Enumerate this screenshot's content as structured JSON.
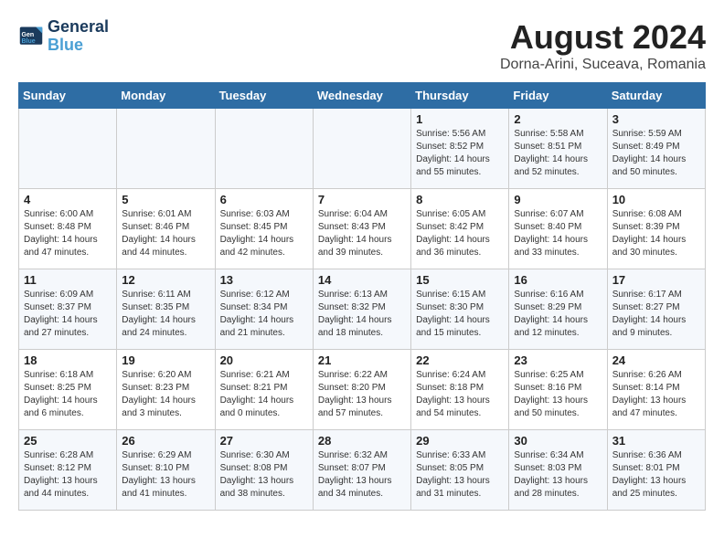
{
  "header": {
    "logo_line1": "General",
    "logo_line2": "Blue",
    "month_year": "August 2024",
    "location": "Dorna-Arini, Suceava, Romania"
  },
  "weekdays": [
    "Sunday",
    "Monday",
    "Tuesday",
    "Wednesday",
    "Thursday",
    "Friday",
    "Saturday"
  ],
  "weeks": [
    [
      {
        "day": "",
        "info": ""
      },
      {
        "day": "",
        "info": ""
      },
      {
        "day": "",
        "info": ""
      },
      {
        "day": "",
        "info": ""
      },
      {
        "day": "1",
        "info": "Sunrise: 5:56 AM\nSunset: 8:52 PM\nDaylight: 14 hours\nand 55 minutes."
      },
      {
        "day": "2",
        "info": "Sunrise: 5:58 AM\nSunset: 8:51 PM\nDaylight: 14 hours\nand 52 minutes."
      },
      {
        "day": "3",
        "info": "Sunrise: 5:59 AM\nSunset: 8:49 PM\nDaylight: 14 hours\nand 50 minutes."
      }
    ],
    [
      {
        "day": "4",
        "info": "Sunrise: 6:00 AM\nSunset: 8:48 PM\nDaylight: 14 hours\nand 47 minutes."
      },
      {
        "day": "5",
        "info": "Sunrise: 6:01 AM\nSunset: 8:46 PM\nDaylight: 14 hours\nand 44 minutes."
      },
      {
        "day": "6",
        "info": "Sunrise: 6:03 AM\nSunset: 8:45 PM\nDaylight: 14 hours\nand 42 minutes."
      },
      {
        "day": "7",
        "info": "Sunrise: 6:04 AM\nSunset: 8:43 PM\nDaylight: 14 hours\nand 39 minutes."
      },
      {
        "day": "8",
        "info": "Sunrise: 6:05 AM\nSunset: 8:42 PM\nDaylight: 14 hours\nand 36 minutes."
      },
      {
        "day": "9",
        "info": "Sunrise: 6:07 AM\nSunset: 8:40 PM\nDaylight: 14 hours\nand 33 minutes."
      },
      {
        "day": "10",
        "info": "Sunrise: 6:08 AM\nSunset: 8:39 PM\nDaylight: 14 hours\nand 30 minutes."
      }
    ],
    [
      {
        "day": "11",
        "info": "Sunrise: 6:09 AM\nSunset: 8:37 PM\nDaylight: 14 hours\nand 27 minutes."
      },
      {
        "day": "12",
        "info": "Sunrise: 6:11 AM\nSunset: 8:35 PM\nDaylight: 14 hours\nand 24 minutes."
      },
      {
        "day": "13",
        "info": "Sunrise: 6:12 AM\nSunset: 8:34 PM\nDaylight: 14 hours\nand 21 minutes."
      },
      {
        "day": "14",
        "info": "Sunrise: 6:13 AM\nSunset: 8:32 PM\nDaylight: 14 hours\nand 18 minutes."
      },
      {
        "day": "15",
        "info": "Sunrise: 6:15 AM\nSunset: 8:30 PM\nDaylight: 14 hours\nand 15 minutes."
      },
      {
        "day": "16",
        "info": "Sunrise: 6:16 AM\nSunset: 8:29 PM\nDaylight: 14 hours\nand 12 minutes."
      },
      {
        "day": "17",
        "info": "Sunrise: 6:17 AM\nSunset: 8:27 PM\nDaylight: 14 hours\nand 9 minutes."
      }
    ],
    [
      {
        "day": "18",
        "info": "Sunrise: 6:18 AM\nSunset: 8:25 PM\nDaylight: 14 hours\nand 6 minutes."
      },
      {
        "day": "19",
        "info": "Sunrise: 6:20 AM\nSunset: 8:23 PM\nDaylight: 14 hours\nand 3 minutes."
      },
      {
        "day": "20",
        "info": "Sunrise: 6:21 AM\nSunset: 8:21 PM\nDaylight: 14 hours\nand 0 minutes."
      },
      {
        "day": "21",
        "info": "Sunrise: 6:22 AM\nSunset: 8:20 PM\nDaylight: 13 hours\nand 57 minutes."
      },
      {
        "day": "22",
        "info": "Sunrise: 6:24 AM\nSunset: 8:18 PM\nDaylight: 13 hours\nand 54 minutes."
      },
      {
        "day": "23",
        "info": "Sunrise: 6:25 AM\nSunset: 8:16 PM\nDaylight: 13 hours\nand 50 minutes."
      },
      {
        "day": "24",
        "info": "Sunrise: 6:26 AM\nSunset: 8:14 PM\nDaylight: 13 hours\nand 47 minutes."
      }
    ],
    [
      {
        "day": "25",
        "info": "Sunrise: 6:28 AM\nSunset: 8:12 PM\nDaylight: 13 hours\nand 44 minutes."
      },
      {
        "day": "26",
        "info": "Sunrise: 6:29 AM\nSunset: 8:10 PM\nDaylight: 13 hours\nand 41 minutes."
      },
      {
        "day": "27",
        "info": "Sunrise: 6:30 AM\nSunset: 8:08 PM\nDaylight: 13 hours\nand 38 minutes."
      },
      {
        "day": "28",
        "info": "Sunrise: 6:32 AM\nSunset: 8:07 PM\nDaylight: 13 hours\nand 34 minutes."
      },
      {
        "day": "29",
        "info": "Sunrise: 6:33 AM\nSunset: 8:05 PM\nDaylight: 13 hours\nand 31 minutes."
      },
      {
        "day": "30",
        "info": "Sunrise: 6:34 AM\nSunset: 8:03 PM\nDaylight: 13 hours\nand 28 minutes."
      },
      {
        "day": "31",
        "info": "Sunrise: 6:36 AM\nSunset: 8:01 PM\nDaylight: 13 hours\nand 25 minutes."
      }
    ]
  ]
}
